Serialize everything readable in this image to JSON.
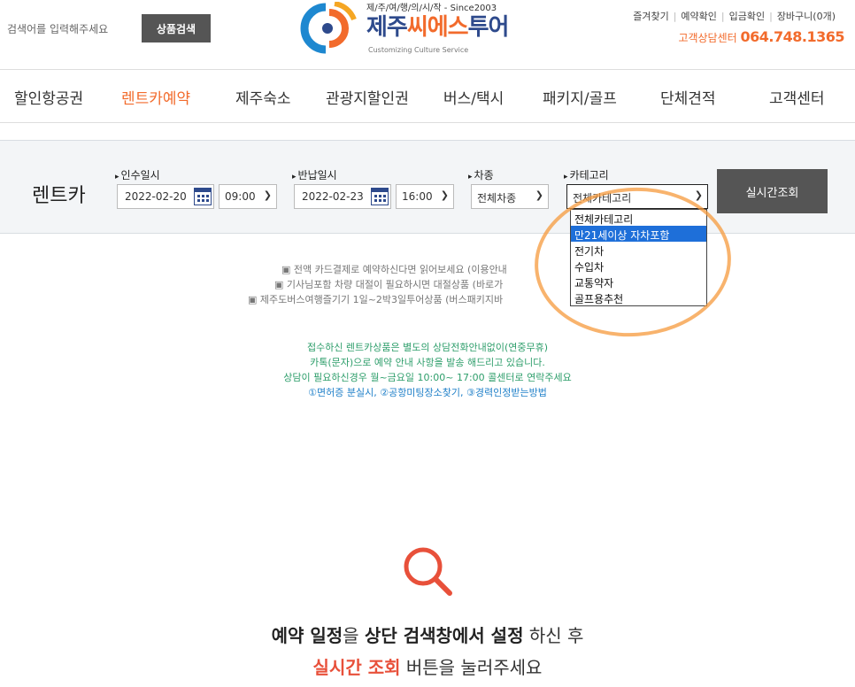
{
  "header": {
    "search_placeholder": "검색어를 입력해주세요",
    "search_button": "상품검색",
    "logo_top": "제/주/여/행/의/시/작 - Since2003",
    "logo_main_a": "제주",
    "logo_main_b": "씨에스",
    "logo_main_c": "투어",
    "logo_sub": "Customizing Culture Service",
    "util_links": [
      "즐겨찾기",
      "예약확인",
      "입금확인",
      "장바구니(0개)"
    ],
    "cs_label": "고객상담센터",
    "cs_phone": "064.748.1365"
  },
  "nav": {
    "items": [
      "할인항공권",
      "렌트카예약",
      "제주숙소",
      "관광지할인권",
      "버스/택시",
      "패키지/골프",
      "단체견적",
      "고객센터"
    ],
    "active_index": 1
  },
  "panel": {
    "title": "렌트카",
    "pickup_label": "인수일시",
    "pickup_date": "2022-02-20",
    "pickup_time": "09:00",
    "return_label": "반납일시",
    "return_date": "2022-02-23",
    "return_time": "16:00",
    "car_type_label": "차종",
    "car_type_value": "전체차종",
    "category_label": "카테고리",
    "category_value": "전체카테고리",
    "search_button": "실시간조회"
  },
  "dropdown": {
    "options": [
      "전체카테고리",
      "만21세이상 자차포함",
      "전기차",
      "수입차",
      "교통약자",
      "골프용추천"
    ],
    "highlighted_index": 1
  },
  "notices": {
    "line1": "▣ 전액 카드결제로 예약하신다면 읽어보세요 (이용안내",
    "line2": "▣ 기사님포함 차량 대절이 필요하시면 대절상품 (바로가",
    "line3": "▣ 제주도버스여행즐기기 1일~2박3일투어상품 (버스패키지바"
  },
  "info": {
    "line1": "접수하신 렌트카상품은 별도의 상담전화안내없이(연중무휴)",
    "line2": "카톡(문자)으로 예약 안내 사항을 발송 해드리고 있습니다.",
    "line3": "상담이 필요하신경우 월~금요일 10:00~ 17:00 콜센터로 연락주세요",
    "line4": "①면허증 분실시, ②공항미팅장소찾기, ③경력인정받는방법"
  },
  "guide": {
    "l1_a": "예약 일정",
    "l1_b": "을 ",
    "l1_c": "상단 검색창에서 설정",
    "l1_d": " 하신 후",
    "l2_a": "실시간 조회",
    "l2_b": " 버튼을 눌러주세요"
  },
  "colors": {
    "accent": "#f26b2c",
    "brand_blue": "#2e4a8c",
    "button_gray": "#555555",
    "info_green": "#2e9e6b",
    "info_blue": "#1e7fc8",
    "highlight_red": "#e8503a",
    "dropdown_highlight": "#1e6fd9"
  }
}
